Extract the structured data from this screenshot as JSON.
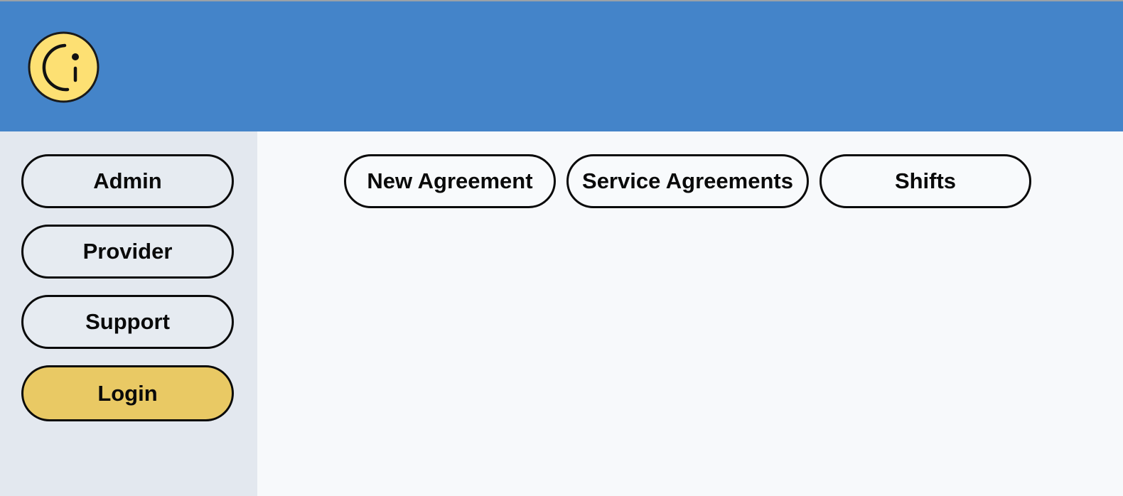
{
  "header": {
    "logo_icon": "info-smiley-icon",
    "background_color": "#4484c9",
    "logo_color": "#fde073"
  },
  "sidebar": {
    "background_color": "#e3e8ef",
    "items": [
      {
        "label": "Admin"
      },
      {
        "label": "Provider"
      },
      {
        "label": "Support"
      },
      {
        "label": "Login",
        "accent_color": "#e9c964"
      }
    ]
  },
  "main": {
    "tabs": [
      {
        "label": "New Agreement"
      },
      {
        "label": "Service Agreements"
      },
      {
        "label": "Shifts"
      }
    ]
  }
}
